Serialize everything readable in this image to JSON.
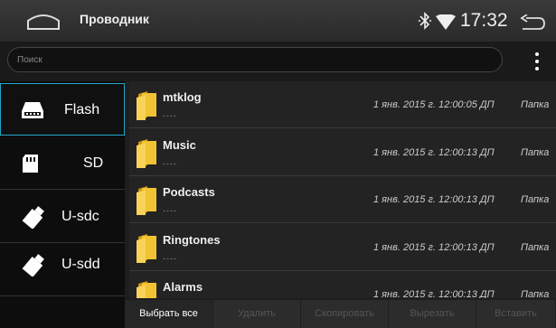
{
  "topbar": {
    "title": "Проводник",
    "time": "17:32",
    "icons": [
      "home-icon",
      "bluetooth-icon",
      "wifi-icon",
      "back-icon"
    ]
  },
  "search": {
    "placeholder": "Поиск",
    "value": ""
  },
  "sidebar": {
    "items": [
      {
        "label": "Flash",
        "icon": "flash-drive-icon",
        "selected": true
      },
      {
        "label": "SD",
        "icon": "sd-card-icon",
        "selected": false
      },
      {
        "label": "U-sdc",
        "icon": "usb-icon",
        "selected": false
      },
      {
        "label": "U-sdd",
        "icon": "usb-icon",
        "selected": false
      }
    ]
  },
  "files": [
    {
      "name": "mtklog",
      "sub": "----",
      "date": "1 янв. 2015 г. 12:00:05 ДП",
      "type": "Папка"
    },
    {
      "name": "Music",
      "sub": "----",
      "date": "1 янв. 2015 г. 12:00:13 ДП",
      "type": "Папка"
    },
    {
      "name": "Podcasts",
      "sub": "----",
      "date": "1 янв. 2015 г. 12:00:13 ДП",
      "type": "Папка"
    },
    {
      "name": "Ringtones",
      "sub": "----",
      "date": "1 янв. 2015 г. 12:00:13 ДП",
      "type": "Папка"
    },
    {
      "name": "Alarms",
      "sub": "----",
      "date": "1 янв. 2015 г. 12:00:13 ДП",
      "type": "Папка"
    }
  ],
  "actions": {
    "select_all": "Выбрать все",
    "delete": "Удалить",
    "copy": "Скопировать",
    "cut": "Вырезать",
    "paste": "Вставить"
  },
  "colors": {
    "accent": "#22a6c8",
    "folder": "#f2c233",
    "background": "#1e1e1e"
  }
}
